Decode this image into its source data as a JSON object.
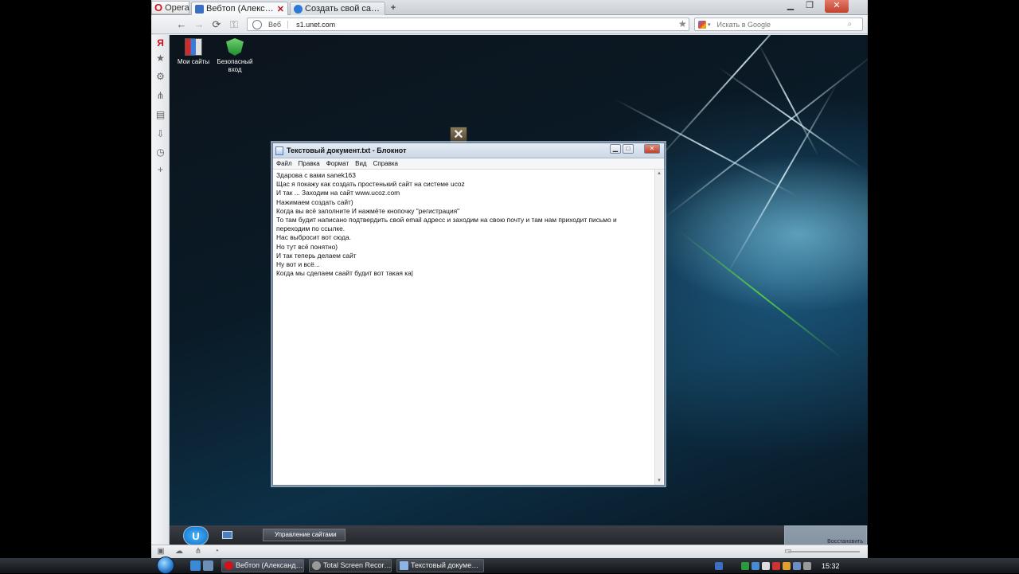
{
  "browser": {
    "opera_button": "Opera",
    "tabs": [
      {
        "label": "Вебтоп (Александр Пих…",
        "active": true
      },
      {
        "label": "Создать свой сайт - uCoz",
        "active": false
      }
    ],
    "address": {
      "prefix": "Веб",
      "url": "s1.unet.com"
    },
    "search": {
      "placeholder": "Искать в Google"
    }
  },
  "desktop": {
    "icons": [
      {
        "label": "Мои сайты",
        "icon": "folders-icon"
      },
      {
        "label": "Безопасный вход",
        "icon": "shield-check-icon"
      }
    ]
  },
  "notepad": {
    "title": "Текстовый документ.txt - Блокнот",
    "menu": [
      "Файл",
      "Правка",
      "Формат",
      "Вид",
      "Справка"
    ],
    "text": "Здарова с вами sanek163\nЩас я покажу как создать простенький сайт на системе ucoz\nИ так ... Заходим на сайт www.ucoz.com\nНажимаем создать сайт)\nКогда вы всё заполните И нажмёте кнопочку \"регистрация\"\nТо там будит написано подтвердить свой email адресс и заходим на свою почту и там нам приходит письмо и\nпереходим по ссылке.\nНас выбросит вот сюда.\nНо тут всё понятно)\nИ так теперь делаем сайт\nНу вот и всё...\nКогда мы сделаем саайт будит вот такая ка|"
  },
  "remote_taskbar": {
    "orb_label": "U",
    "task": "Управление сайтами",
    "thumb_label": "Восстановить"
  },
  "taskbar": {
    "tasks": [
      "Вебтоп (Александ…",
      "Total Screen Recor…",
      "Текстовый докуме…"
    ],
    "clock": "15:32"
  }
}
